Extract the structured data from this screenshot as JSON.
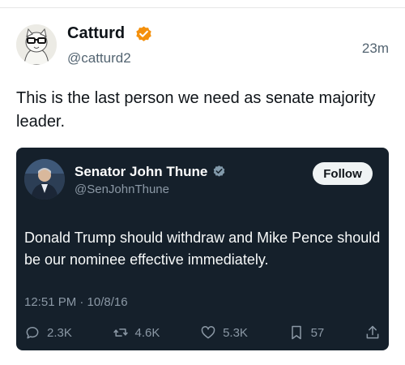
{
  "post": {
    "author_name": "Catturd",
    "handle": "@catturd2",
    "timestamp": "23m",
    "text": "This is the last person we need as senate majority leader.",
    "verified_color": "#f4900c"
  },
  "quoted": {
    "author_name": "Senator John Thune",
    "handle": "@SenJohnThune",
    "follow_label": "Follow",
    "text": "Donald Trump should withdraw and Mike Pence should be our nominee effective immediately.",
    "time": "12:51 PM · 10/8/16",
    "replies": "2.3K",
    "reposts": "4.6K",
    "likes": "5.3K",
    "bookmarks": "57",
    "icons": {
      "reply": "reply-icon",
      "repost": "repost-icon",
      "like": "like-icon",
      "bookmark": "bookmark-icon",
      "share": "share-icon"
    },
    "card_color": "#15202b",
    "verified_color": "#829aab"
  }
}
